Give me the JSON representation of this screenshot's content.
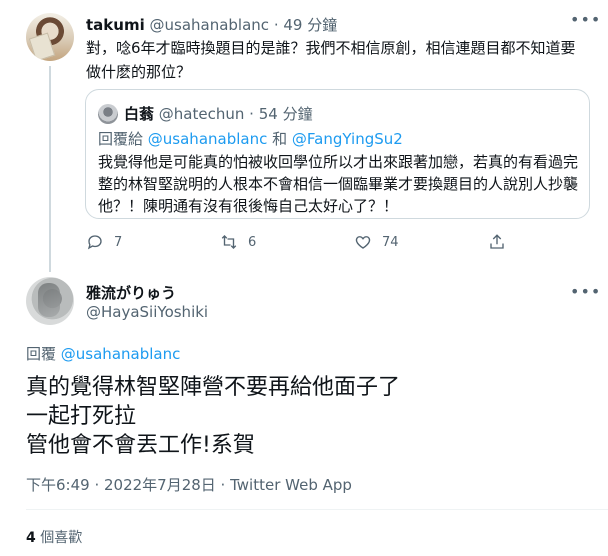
{
  "parent_tweet": {
    "display_name": "takumi",
    "handle": "@usahanablanc",
    "separator": "·",
    "time_ago": "49 分鐘",
    "text": "對，唸6年才臨時換題目的是誰？我們不相信原創，相信連題目都不知道要做什麽的那位？",
    "quoted_tweet": {
      "display_name": "白蓊",
      "handle": "@hatechun",
      "separator": "·",
      "time_ago": "54 分鐘",
      "reply_prefix": "回覆給",
      "reply_user1": "@usahanablanc",
      "reply_and": "和",
      "reply_user2": "@FangYingSu2",
      "text": "我覺得他是可能真的怕被收回學位所以才出來跟著加戀，若真的有看過完整的林智堅說明的人根本不會相信一個臨畢業才要換題目的人說別人抄襲他？！陳明通有沒有很後悔自己太好心了？！"
    },
    "actions": {
      "reply_count": "7",
      "retweet_count": "6",
      "like_count": "74"
    }
  },
  "focused_tweet": {
    "display_name": "雅流がりゅう",
    "handle": "@HayaSiiYoshiki",
    "reply_prefix": "回覆",
    "reply_user": "@usahanablanc",
    "lines": [
      "真的覺得林智堅陣營不要再給他面子了",
      "一起打死拉",
      "管他會不會丟工作!系賀"
    ],
    "timestamp": "下午6:49 · 2022年7月28日 · Twitter Web App",
    "likes_count": "4",
    "likes_label": "個喜歡"
  },
  "icons": {
    "more": "more-horizontal-icon",
    "reply": "reply-icon",
    "retweet": "retweet-icon",
    "like": "heart-icon"
  },
  "colors": {
    "link": "#1d9bf0",
    "muted": "#536471",
    "text": "#0f1419",
    "border": "#cfd9de"
  }
}
